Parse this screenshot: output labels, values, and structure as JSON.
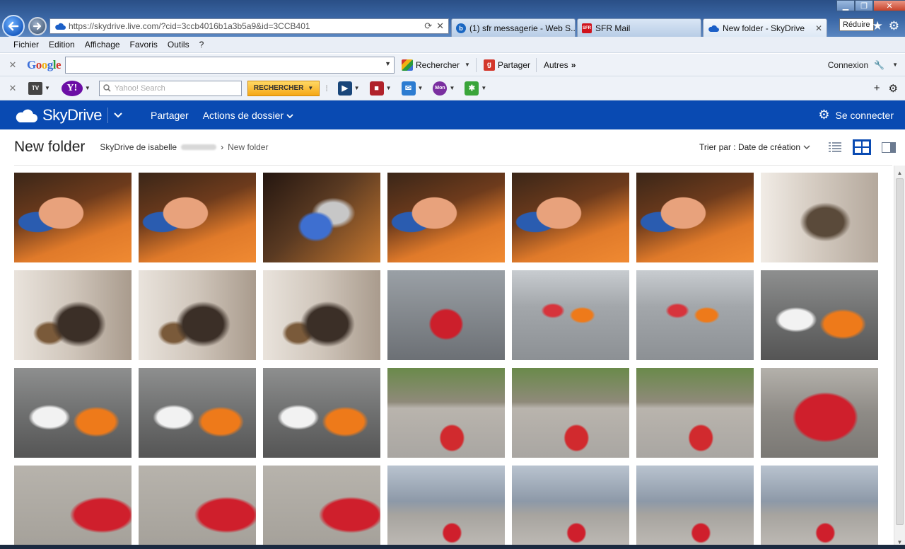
{
  "browser": {
    "address_bar": {
      "url": "https://skydrive.live.com/?cid=3ccb4016b1a3b5a9&id=3CCB401"
    },
    "tabs": [
      {
        "label": "(1) sfr messagerie - Web S...",
        "favicon": "b"
      },
      {
        "label": "SFR Mail",
        "favicon": "SFR"
      },
      {
        "label": "New folder - SkyDrive",
        "favicon": ""
      }
    ],
    "tooltip": "Réduire"
  },
  "menubar": {
    "items": [
      "Fichier",
      "Edition",
      "Affichage",
      "Favoris",
      "Outils",
      "?"
    ]
  },
  "google_toolbar": {
    "logo": "Google",
    "search_button": "Rechercher",
    "share_button": "Partager",
    "more": "Autres",
    "login": "Connexion"
  },
  "yahoo_toolbar": {
    "tv_label": "orange TV",
    "logo": "Y!",
    "search_placeholder": "Yahoo! Search",
    "search_button": "RECHERCHER",
    "mail_icon_label": "Mail"
  },
  "skydrive": {
    "logo_text": "SkyDrive",
    "menu": [
      "Partager",
      "Actions de dossier"
    ],
    "signin": "Se connecter",
    "folder_title": "New folder",
    "breadcrumb_root": "SkyDrive de isabelle",
    "breadcrumb_current": "New folder",
    "sort_label": "Trier par : Date de création",
    "colors": {
      "header_bg": "#094ab2",
      "accent": "#094ab2"
    }
  },
  "photos": [
    {
      "theme": "ph-face"
    },
    {
      "theme": "ph-face"
    },
    {
      "theme": "ph-blur"
    },
    {
      "theme": "ph-face"
    },
    {
      "theme": "ph-face"
    },
    {
      "theme": "ph-face"
    },
    {
      "theme": "ph-room"
    },
    {
      "theme": "ph-room2"
    },
    {
      "theme": "ph-room2"
    },
    {
      "theme": "ph-room2"
    },
    {
      "theme": "ph-street"
    },
    {
      "theme": "ph-street2"
    },
    {
      "theme": "ph-street2"
    },
    {
      "theme": "ph-people"
    },
    {
      "theme": "ph-people"
    },
    {
      "theme": "ph-people"
    },
    {
      "theme": "ph-people"
    },
    {
      "theme": "ph-plaza"
    },
    {
      "theme": "ph-plaza"
    },
    {
      "theme": "ph-plaza"
    },
    {
      "theme": "ph-car"
    },
    {
      "theme": "ph-ground"
    },
    {
      "theme": "ph-ground"
    },
    {
      "theme": "ph-ground"
    },
    {
      "theme": "ph-pompidou"
    },
    {
      "theme": "ph-pompidou"
    },
    {
      "theme": "ph-pompidou"
    },
    {
      "theme": "ph-pompidou"
    }
  ]
}
